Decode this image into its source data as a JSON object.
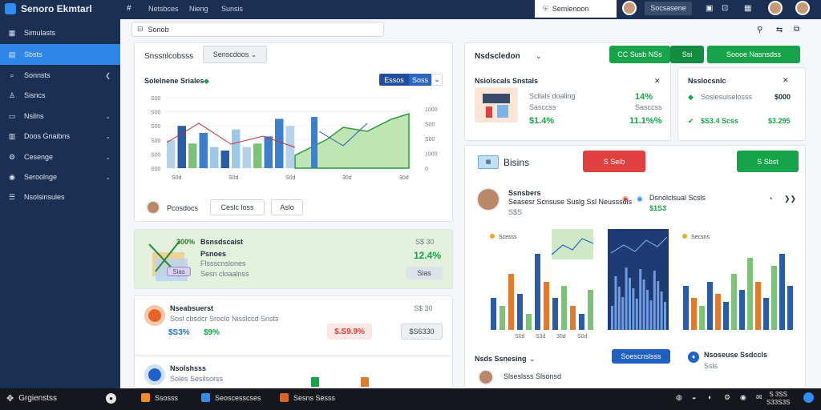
{
  "topbar": {
    "app_title": "Senoro Ekmtarl",
    "nav": [
      "Netsbces",
      "Nieng",
      "Sunsis"
    ],
    "search_text": "Semlenoon",
    "button": "Socsasene",
    "right_icons": [
      "square-icon",
      "box-icon",
      "grid-icon"
    ]
  },
  "sidebar": {
    "items": [
      {
        "label": "Simulasts",
        "icon": "dashboard-icon"
      },
      {
        "label": "Sbsts",
        "icon": "grid-icon"
      },
      {
        "label": "Sonnsts",
        "icon": "search-icon"
      },
      {
        "label": "Sisncs",
        "icon": "user-icon"
      },
      {
        "label": "Nsilns",
        "icon": "folder-icon"
      },
      {
        "label": "Doos Gnaibns",
        "icon": "chart-icon"
      },
      {
        "label": "Cesenge",
        "icon": "settings-icon"
      },
      {
        "label": "Seroolnge",
        "icon": "globe-icon"
      },
      {
        "label": "Nsolsinsules",
        "icon": "list-icon"
      }
    ]
  },
  "pathbar": {
    "label": "Sonob"
  },
  "left_panel": {
    "header": "Snssnlcobsss",
    "dropdown": "Senscdoos",
    "chart_title": "Solelnene Sriales",
    "toggle": [
      "Essos",
      "Soss"
    ],
    "footer_name": "Pcosdocs",
    "footer_btns": [
      "Ceslc loss",
      "Aslo"
    ]
  },
  "chart_data": {
    "type": "bar",
    "categories": [
      "S0d",
      "S0d",
      "S0d",
      "30d",
      "30d"
    ],
    "left_ticks": [
      "S00",
      "S00",
      "S00",
      "S00",
      "S00",
      "S00"
    ],
    "right_ticks": [
      "1000",
      "S00",
      "S00",
      "1000",
      "0"
    ],
    "series": [
      {
        "values": [
          0.4,
          0.6,
          0.35,
          0.5,
          0.3,
          0.25,
          0.55,
          0.3,
          0.35,
          0.45,
          0.7,
          0.6
        ]
      }
    ]
  },
  "promo": {
    "title": "Bsnsdscaist",
    "sub1": "Psnoes",
    "sub2": "Flssscnslones",
    "sub3": "Sesn cloaalnss",
    "right_top": "S$ 30",
    "value": "12.4%",
    "pill": "Sias",
    "badge": "300%"
  },
  "txn_card": {
    "title": "Nseabsuerst",
    "sub": "Sosl cbsdcr Sroclo Nisslccd Snsts",
    "right_top": "S$ 30",
    "v1": "$S3%",
    "v2": "$9%",
    "v3": "$.S9.9%",
    "v4": "$S6330"
  },
  "bottom_card": {
    "title": "Nsolshsss",
    "sub": "Soles Sesilsorss"
  },
  "notif_card": {
    "title": "Nsdscledon",
    "buttons": [
      "CC Susb NSs",
      "Ssi",
      "Soooe Nasnsdss"
    ],
    "heading": "Nsiolscals Snstals",
    "label1": "Scllals doaling",
    "val1": "$1.4%",
    "pct1": "14%",
    "pct2": "11.1%%",
    "label2": "Sasccss"
  },
  "small_card": {
    "title": "Nsslocsnlc",
    "l1": "Sosiesulselosss",
    "v1": "$000",
    "l2": "$S3.4 Scss",
    "v2": "$3.295"
  },
  "dashboard": {
    "title": "Bisins",
    "btn_red": "S Seib",
    "btn_green": "S Sbst",
    "person_name": "Ssnsbers",
    "person_sub": "Seasesr Scnsuse Suslg Ssl Neusssdls",
    "sub_val": "S$S",
    "status": "Dsnolclsual Scsls",
    "status_val": "$1S3",
    "legend1": "Scesss",
    "legend2": "Secsns",
    "ticks": [
      "S0d",
      "S3d",
      "30d",
      "S0d"
    ],
    "footer_title": "Nsds Ssnesing",
    "footer_btn": "Soescnslsss",
    "footer_sub": "Nsoseuse Ssdccls",
    "footer_sub2": "Ssls",
    "footer_person": "Slseslsss Slsonsd"
  },
  "taskbar": {
    "start_label": "Grgienstss",
    "apps": [
      {
        "label": "Ssosss",
        "color": "#f08a24"
      },
      {
        "label": "Seoscesscses",
        "color": "#2f8df5"
      },
      {
        "label": "Sesns Sesss",
        "color": "#e2631f"
      }
    ],
    "time": "S 3SS",
    "date": "S33S3S"
  }
}
